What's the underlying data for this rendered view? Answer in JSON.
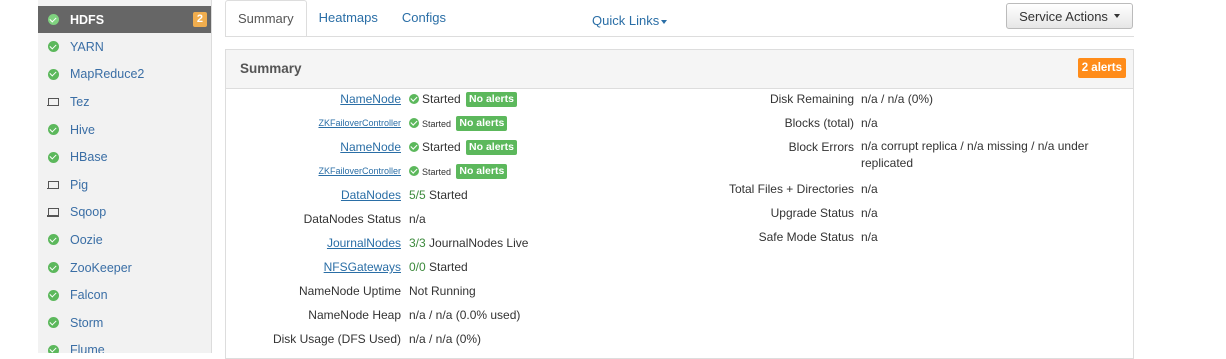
{
  "sidebar": {
    "items": [
      {
        "label": "HDFS",
        "icon": "check-circle-icon",
        "active": true,
        "badge": "2"
      },
      {
        "label": "YARN",
        "icon": "check-circle-icon"
      },
      {
        "label": "MapReduce2",
        "icon": "check-circle-icon"
      },
      {
        "label": "Tez",
        "icon": "laptop-icon"
      },
      {
        "label": "Hive",
        "icon": "check-circle-icon"
      },
      {
        "label": "HBase",
        "icon": "check-circle-icon"
      },
      {
        "label": "Pig",
        "icon": "laptop-icon"
      },
      {
        "label": "Sqoop",
        "icon": "laptop-icon"
      },
      {
        "label": "Oozie",
        "icon": "check-circle-icon"
      },
      {
        "label": "ZooKeeper",
        "icon": "check-circle-icon"
      },
      {
        "label": "Falcon",
        "icon": "check-circle-icon"
      },
      {
        "label": "Storm",
        "icon": "check-circle-icon"
      },
      {
        "label": "Flume",
        "icon": "check-circle-icon"
      }
    ]
  },
  "tabs": [
    {
      "label": "Summary",
      "active": true
    },
    {
      "label": "Heatmaps"
    },
    {
      "label": "Configs"
    }
  ],
  "quick_links": "Quick Links",
  "service_actions": "Service Actions",
  "summary": {
    "title": "Summary",
    "alerts_badge": "2 alerts",
    "left": [
      {
        "label": "NameNode",
        "link": true,
        "status": "Started",
        "alerts": "No alerts"
      },
      {
        "label": "ZKFailoverController",
        "link": true,
        "small": true,
        "status": "Started",
        "alerts": "No alerts"
      },
      {
        "label": "NameNode",
        "link": true,
        "status": "Started",
        "alerts": "No alerts"
      },
      {
        "label": "ZKFailoverController",
        "link": true,
        "small": true,
        "status": "Started",
        "alerts": "No alerts"
      },
      {
        "label": "DataNodes",
        "link": true,
        "count": "5/5",
        "value": "Started"
      },
      {
        "label": "DataNodes Status",
        "value": "n/a"
      },
      {
        "label": "JournalNodes",
        "link": true,
        "count": "3/3",
        "value": "JournalNodes Live"
      },
      {
        "label": "NFSGateways",
        "link": true,
        "count": "0/0",
        "value": "Started"
      },
      {
        "label": "NameNode Uptime",
        "value": "Not Running"
      },
      {
        "label": "NameNode Heap",
        "value": "n/a / n/a (0.0% used)"
      },
      {
        "label": "Disk Usage (DFS Used)",
        "value": "n/a / n/a (0%)"
      }
    ],
    "right": [
      {
        "label": "Disk Remaining",
        "value": "n/a / n/a (0%)"
      },
      {
        "label": "Blocks (total)",
        "value": "n/a"
      },
      {
        "label": "Block Errors",
        "value": "n/a corrupt replica / n/a missing / n/a under replicated"
      },
      {
        "label": "Total Files + Directories",
        "value": "n/a"
      },
      {
        "label": "Upgrade Status",
        "value": "n/a"
      },
      {
        "label": "Safe Mode Status",
        "value": "n/a"
      }
    ]
  },
  "colors": {
    "link": "#2a6ea6",
    "ok": "#5cb85c",
    "alert": "#ff8c1a",
    "active_item": "#666666"
  }
}
